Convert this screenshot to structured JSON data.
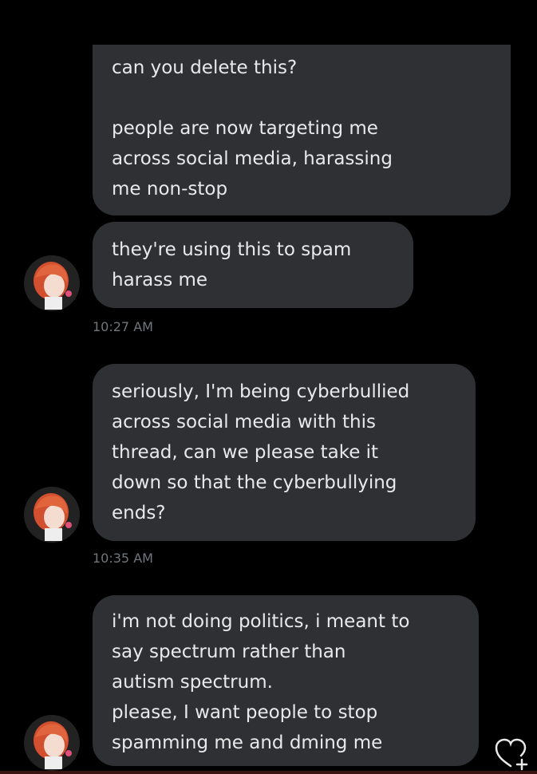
{
  "conversation": {
    "messages": [
      {
        "text": "can you delete this?\n\npeople are now targeting me\nacross social media, harassing\nme non-stop"
      },
      {
        "text": "they're using this to spam\nharass me"
      },
      {
        "text": "seriously, I'm being cyberbullied\nacross social media with this\nthread, can we please take it\ndown so that the cyberbullying\nends?"
      },
      {
        "text": "i'm not doing politics, i meant to\nsay spectrum rather than\nautism spectrum.\nplease, I want people to stop\nspamming me and dming me"
      }
    ],
    "timestamps": [
      "10:27 AM",
      "10:35 AM"
    ]
  },
  "colors": {
    "background": "#000000",
    "bubble": "#2f3033",
    "text": "#e7e9ea",
    "timestamp": "#71767b"
  },
  "icons": {
    "avatar": "anime-avatar-icon",
    "reaction": "heart-plus-icon"
  }
}
